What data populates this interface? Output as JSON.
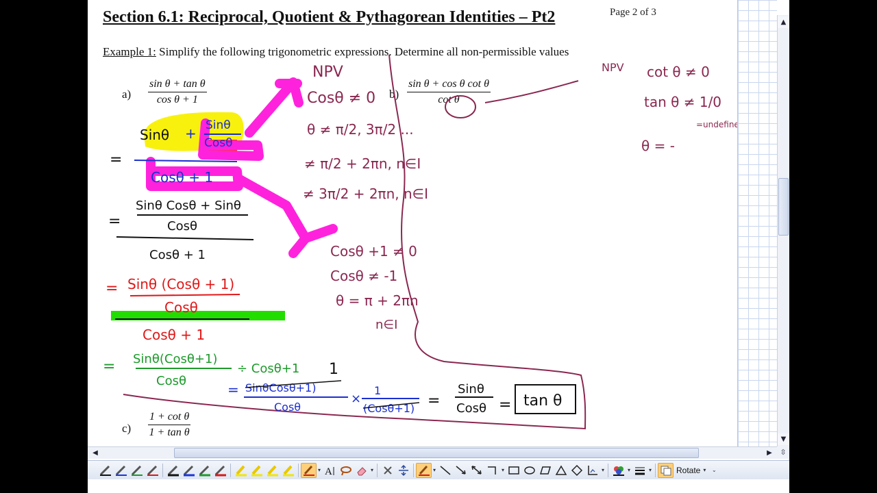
{
  "document": {
    "heading": "Section 6.1: Reciprocal, Quotient & Pythagorean Identities – Pt2",
    "page_counter": "Page 2 of 3",
    "example_label": "Example 1:",
    "example_text": " Simplify the following trigonometric expressions. Determine all non-permissible values",
    "part_a": {
      "label": "a)",
      "numerator": "sin θ + tan θ",
      "denominator": "cos θ + 1"
    },
    "part_b": {
      "label": "b)",
      "numerator": "sin θ + cos θ cot θ",
      "denominator": "cot θ"
    },
    "part_c": {
      "label": "c)",
      "numerator": "1 + cot θ",
      "denominator": "1 + tan θ"
    }
  },
  "handwriting": {
    "npv_a": "NPV",
    "npv_cos": "Cosθ ≠ 0",
    "theta_ne": "θ ≠ π/2, 3π/2 ...",
    "sol1": "≠ π/2 + 2πn, n∈I",
    "sol2": "≠ 3π/2 + 2πn, n∈I",
    "cosplus": "Cosθ +1 ≠ 0",
    "cos_ne_neg1": "Cosθ ≠ -1",
    "theta_pi": "θ = π + 2πn",
    "n_in_i": "n∈I",
    "step1_num_a": "Sinθ",
    "step1_num_b": "Sinθ",
    "step1_num_c": "Cosθ",
    "step1_plus": "+",
    "step1_den": "Cosθ + 1",
    "step2_num": "Sinθ Cosθ + Sinθ",
    "step2_mid": "Cosθ",
    "step2_den": "Cosθ + 1",
    "step3_num": "Sinθ (Cosθ + 1)",
    "step3_mid": "Cosθ",
    "step3_den": "Cosθ + 1",
    "step4_num": "Sinθ(Cosθ+1)",
    "step4_div": "÷ Cosθ+1",
    "step4_den": "Cosθ",
    "step5_num": "SinθCosθ+1)",
    "step5_den": "Cosθ",
    "step5_one": "1",
    "step5_one_b": "1",
    "step5_den2": "(Cosθ+1)",
    "step5_eq_num": "Sinθ",
    "step5_eq_den": "Cosθ",
    "answer": "tan θ",
    "npv_b": "NPV",
    "cot_ne": "cot θ ≠ 0",
    "tan_ne": "tan θ ≠ 1/0",
    "undefined": "=undefined",
    "theta_eq": "θ = -"
  },
  "toolbar": {
    "rotate_label": "Rotate",
    "pen_colors": [
      "#111111",
      "#1a35d6",
      "#1d9a2b",
      "#d41a1a"
    ],
    "highlighter_colors": [
      "#f2e600",
      "#f2e600",
      "#f2e600",
      "#f2e600"
    ],
    "icons": [
      "pen-icon",
      "highlighter-icon",
      "text-icon",
      "lasso-icon",
      "eraser-icon",
      "delete-icon",
      "insert-space-icon",
      "line-icon",
      "arrow-icon",
      "rectangle-icon",
      "ellipse-icon",
      "parallelogram-icon",
      "triangle-icon",
      "diamond-icon",
      "connector-icon",
      "color-icon",
      "line-weight-icon",
      "rotate-icon"
    ]
  },
  "colors": {
    "pink": "#ff22dd",
    "yellow": "#f8f000",
    "green": "#22dd00",
    "maroon": "#8a2750",
    "red": "#e01818",
    "blue": "#1a2fd0"
  }
}
